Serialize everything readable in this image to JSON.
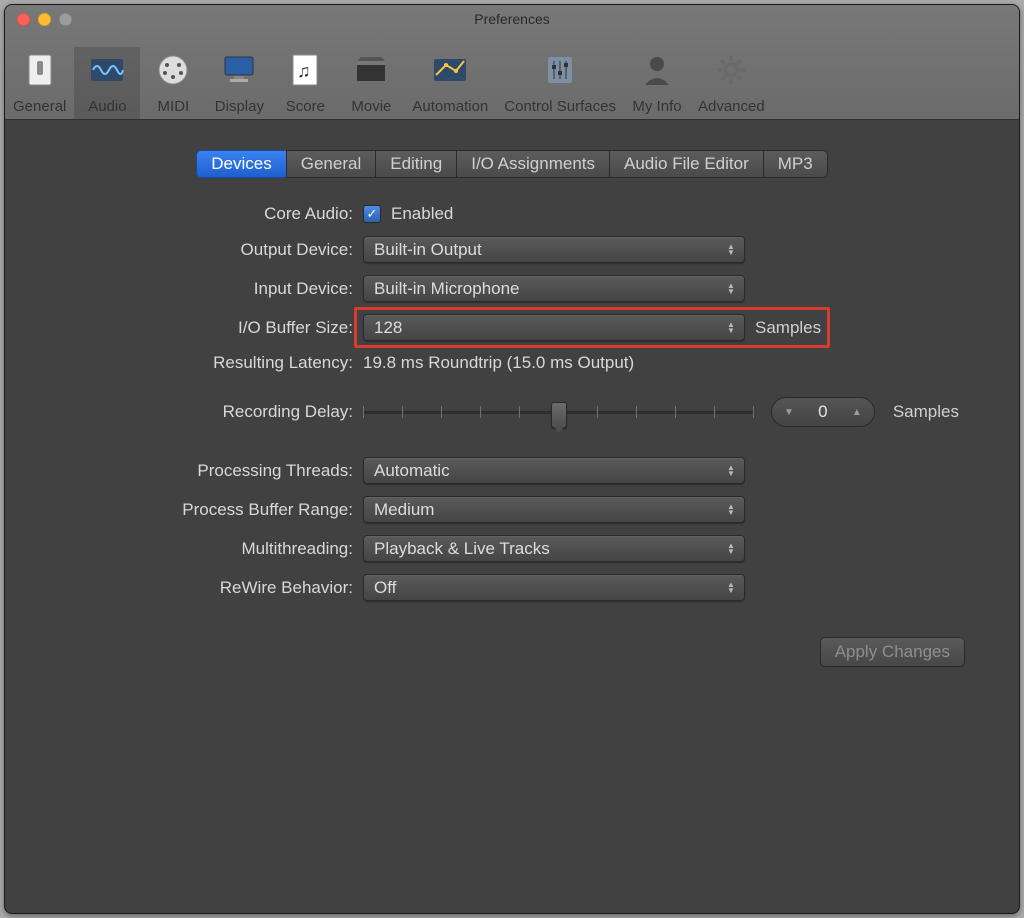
{
  "window": {
    "title": "Preferences"
  },
  "toolbar": [
    {
      "key": "general",
      "label": "General"
    },
    {
      "key": "audio",
      "label": "Audio",
      "selected": true
    },
    {
      "key": "midi",
      "label": "MIDI"
    },
    {
      "key": "display",
      "label": "Display"
    },
    {
      "key": "score",
      "label": "Score"
    },
    {
      "key": "movie",
      "label": "Movie"
    },
    {
      "key": "automation",
      "label": "Automation"
    },
    {
      "key": "controlsurfaces",
      "label": "Control Surfaces"
    },
    {
      "key": "myinfo",
      "label": "My Info"
    },
    {
      "key": "advanced",
      "label": "Advanced"
    }
  ],
  "tabs": [
    {
      "label": "Devices",
      "active": true
    },
    {
      "label": "General"
    },
    {
      "label": "Editing"
    },
    {
      "label": "I/O Assignments"
    },
    {
      "label": "Audio File Editor"
    },
    {
      "label": "MP3"
    }
  ],
  "form": {
    "core_audio": {
      "label": "Core Audio:",
      "checked": true,
      "value": "Enabled"
    },
    "output_device": {
      "label": "Output Device:",
      "value": "Built-in Output"
    },
    "input_device": {
      "label": "Input Device:",
      "value": "Built-in Microphone"
    },
    "io_buffer": {
      "label": "I/O Buffer Size:",
      "value": "128",
      "suffix": "Samples",
      "highlighted": true
    },
    "resulting_latency": {
      "label": "Resulting Latency:",
      "value": "19.8 ms Roundtrip (15.0 ms Output)"
    },
    "recording_delay": {
      "label": "Recording Delay:",
      "value": "0",
      "suffix": "Samples",
      "slider_pos": 0.5,
      "ticks": 11
    },
    "processing_threads": {
      "label": "Processing Threads:",
      "value": "Automatic"
    },
    "process_buffer": {
      "label": "Process Buffer Range:",
      "value": "Medium"
    },
    "multithreading": {
      "label": "Multithreading:",
      "value": "Playback & Live Tracks"
    },
    "rewire": {
      "label": "ReWire Behavior:",
      "value": "Off"
    }
  },
  "apply_button": "Apply Changes"
}
